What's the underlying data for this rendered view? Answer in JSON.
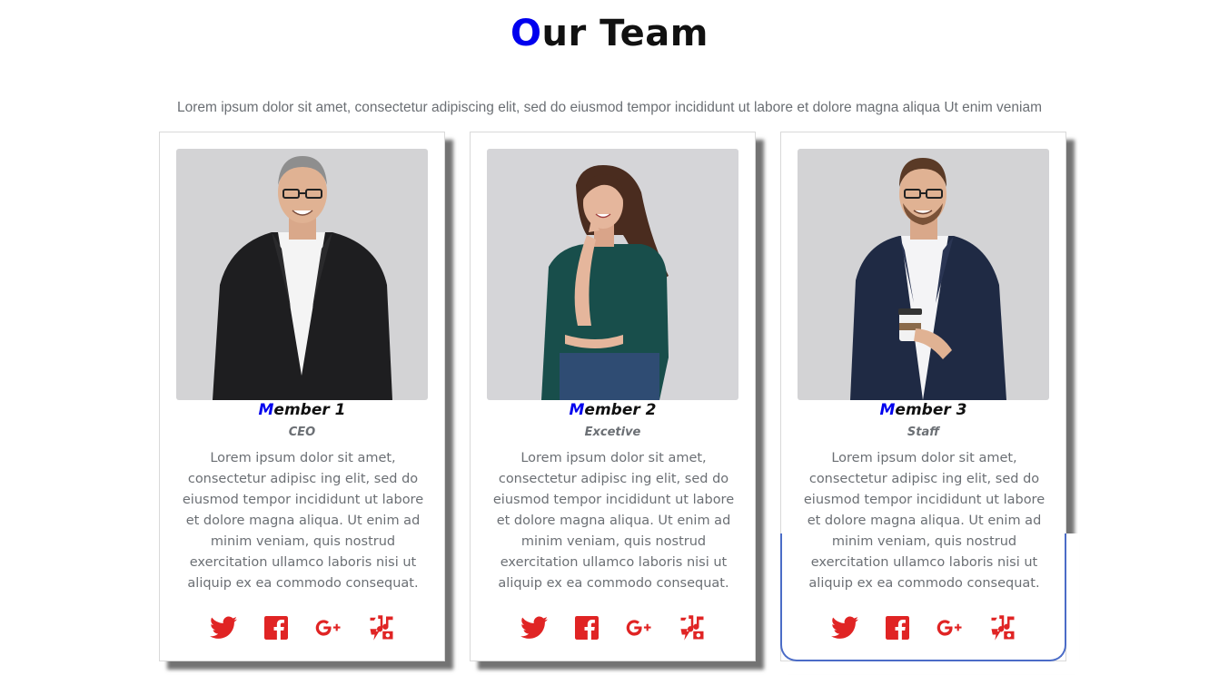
{
  "heading": {
    "first_letter": "O",
    "rest": "ur Team"
  },
  "intro": "Lorem ipsum dolor sit amet, consectetur adipiscing elit, sed do eiusmod tempor incididunt ut labore et dolore magna aliqua Ut enim veniam",
  "accent_color": "#0000ee",
  "social_color": "#e02424",
  "hover_border_color": "#4b6cc7",
  "members": [
    {
      "name_first": "M",
      "name_rest": "ember 1",
      "role": "CEO",
      "photo": "man-in-black-suit-photo",
      "bio": "Lorem ipsum dolor sit amet, consectetur adipisc ing elit, sed do eiusmod tempor incididunt ut labore et dolore magna aliqua. Ut enim ad minim veniam, quis nostrud exercitation ullamco laboris nisi ut aliquip ex ea commodo consequat."
    },
    {
      "name_first": "M",
      "name_rest": "ember 2",
      "role": "Excetive",
      "photo": "woman-in-green-top-photo",
      "bio": "Lorem ipsum dolor sit amet, consectetur adipisc ing elit, sed do eiusmod tempor incididunt ut labore et dolore magna aliqua. Ut enim ad minim veniam, quis nostrud exercitation ullamco laboris nisi ut aliquip ex ea commodo consequat."
    },
    {
      "name_first": "M",
      "name_rest": "ember 3",
      "role": "Staff",
      "photo": "man-in-navy-blazer-with-coffee-photo",
      "bio": "Lorem ipsum dolor sit amet, consectetur adipisc ing elit, sed do eiusmod tempor incididunt ut labore et dolore magna aliqua. Ut enim ad minim veniam, quis nostrud exercitation ullamco laboris nisi ut aliquip ex ea commodo consequat."
    }
  ],
  "social_icons": [
    "twitter-icon",
    "facebook-icon",
    "google-plus-icon",
    "music-icon"
  ]
}
